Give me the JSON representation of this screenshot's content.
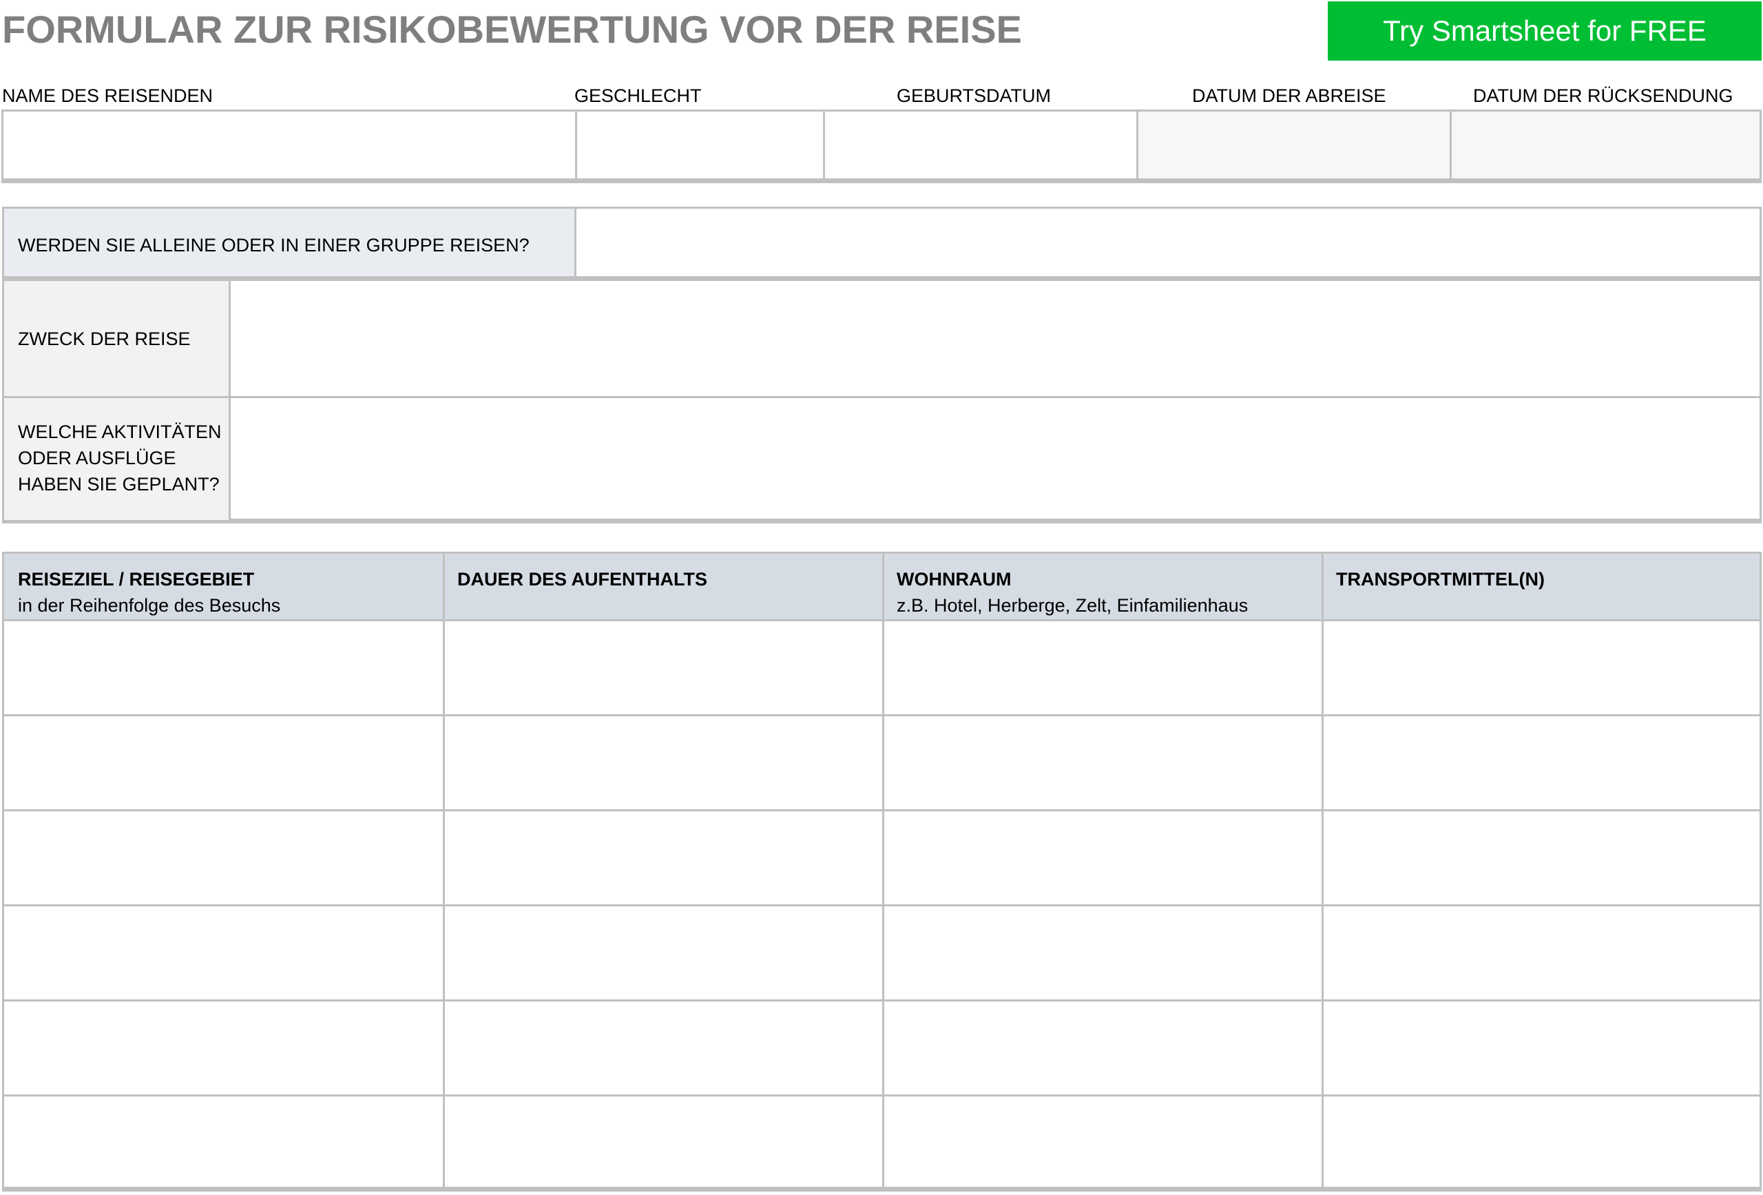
{
  "header": {
    "title": "FORMULAR ZUR RISIKOBEWERTUNG VOR DER REISE",
    "cta_label": "Try Smartsheet for FREE",
    "cta_color": "#00be34",
    "title_color": "#7f7f7f"
  },
  "traveler": {
    "labels": {
      "name": "NAME DES REISENDEN",
      "gender": "GESCHLECHT",
      "dob": "GEBURTSDATUM",
      "departure": "DATUM DER ABREISE",
      "return": "DATUM DER RÜCKSENDUNG"
    },
    "values": {
      "name": "",
      "gender": "",
      "dob": "",
      "departure": "",
      "return": ""
    }
  },
  "questions": {
    "group": {
      "label": "WERDEN SIE ALLEINE ODER IN EINER GRUPPE REISEN?",
      "value": ""
    },
    "purpose": {
      "label": "ZWECK DER REISE",
      "value": ""
    },
    "activities": {
      "label_lines": [
        "WELCHE AKTIVITÄTEN",
        "ODER AUSFLÜGE",
        "HABEN SIE GEPLANT?"
      ],
      "value": ""
    }
  },
  "itinerary": {
    "columns": [
      {
        "title": "REISEZIEL / REISEGEBIET",
        "subtitle": "in der Reihenfolge des Besuchs"
      },
      {
        "title": "DAUER DES AUFENTHALTS",
        "subtitle": ""
      },
      {
        "title": "WOHNRAUM",
        "subtitle": "z.B. Hotel, Herberge, Zelt, Einfamilienhaus"
      },
      {
        "title": "TRANSPORTMITTEL(N)",
        "subtitle": ""
      }
    ],
    "rows": [
      [
        "",
        "",
        "",
        ""
      ],
      [
        "",
        "",
        "",
        ""
      ],
      [
        "",
        "",
        "",
        ""
      ],
      [
        "",
        "",
        "",
        ""
      ],
      [
        "",
        "",
        "",
        ""
      ],
      [
        "",
        "",
        "",
        ""
      ]
    ]
  }
}
